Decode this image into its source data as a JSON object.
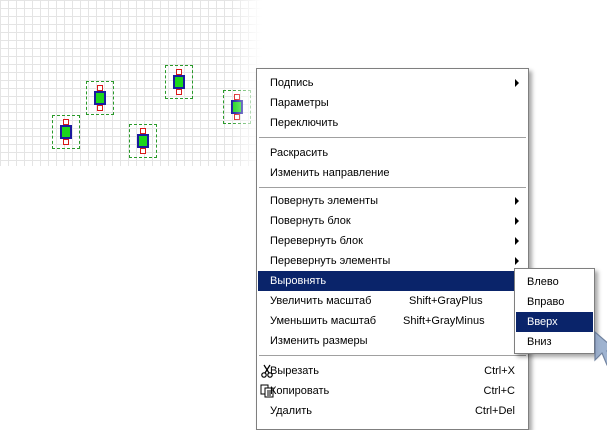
{
  "context_menu": {
    "items": [
      {
        "label": "Подпись",
        "submenu": true
      },
      {
        "label": "Параметры"
      },
      {
        "label": "Переключить"
      },
      {
        "label": "Раскрасить"
      },
      {
        "label": "Изменить направление"
      },
      {
        "label": "Повернуть элементы",
        "submenu": true
      },
      {
        "label": "Повернуть блок",
        "submenu": true
      },
      {
        "label": "Перевернуть блок",
        "submenu": true
      },
      {
        "label": "Перевернуть элементы",
        "submenu": true
      },
      {
        "label": "Выровнять",
        "submenu": true,
        "selected": true
      },
      {
        "label": "Увеличить масштаб",
        "shortcut": "Shift+GrayPlus"
      },
      {
        "label": "Уменьшить масштаб",
        "shortcut": "Shift+GrayMinus"
      },
      {
        "label": "Изменить размеры"
      },
      {
        "label": "Вырезать",
        "shortcut": "Ctrl+X",
        "icon": "scissors-icon"
      },
      {
        "label": "Копировать",
        "shortcut": "Ctrl+C",
        "icon": "copy-icon"
      },
      {
        "label": "Удалить",
        "shortcut": "Ctrl+Del"
      }
    ]
  },
  "align_submenu": {
    "items": [
      {
        "label": "Влево"
      },
      {
        "label": "Вправо"
      },
      {
        "label": "Вверх",
        "selected": true
      },
      {
        "label": "Вниз"
      }
    ]
  },
  "colors": {
    "selection": "#0a246a",
    "component_body": "#1bd61b",
    "component_border": "#1a1a9e",
    "pin": "#d81818",
    "selection_frame": "#2a9a2a"
  }
}
